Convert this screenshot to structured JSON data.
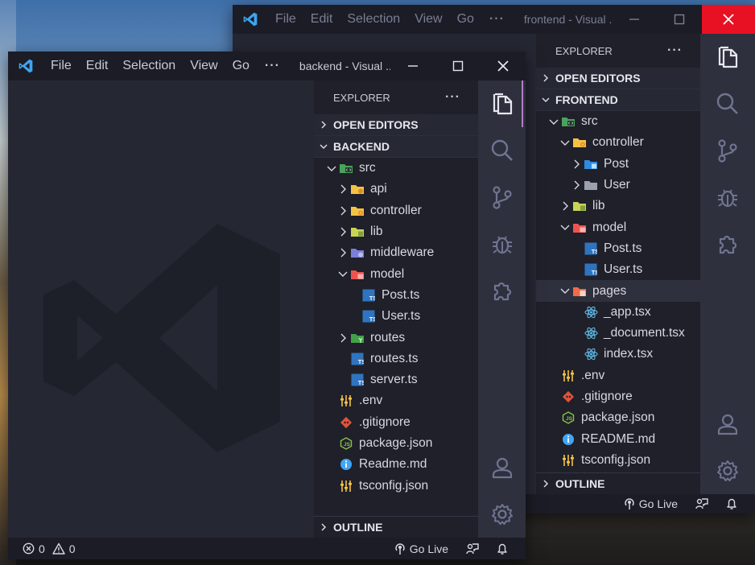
{
  "colors": {
    "title_bg": "#1b1c25",
    "editor_bg": "#252733",
    "sidebar_bg": "#1f2029",
    "activity_bg": "#2e303d",
    "accent_close": "#e81123",
    "vscode_blue": "#3ea5f0",
    "folder_yellow": "#f5c343",
    "ts_blue": "#2f74c0",
    "react_blue": "#5fb8e6"
  },
  "menu": [
    "File",
    "Edit",
    "Selection",
    "View",
    "Go"
  ],
  "menu_more": "···",
  "front": {
    "title": "backend - Visual ...",
    "explorer_title": "EXPLORER",
    "explorer_more": "···",
    "open_editors": "OPEN EDITORS",
    "root": "BACKEND",
    "tree": [
      {
        "label": "src",
        "depth": 1,
        "twisty": "open",
        "icon": "folder-src-icon"
      },
      {
        "label": "api",
        "depth": 2,
        "twisty": "closed",
        "icon": "folder-api-icon"
      },
      {
        "label": "controller",
        "depth": 2,
        "twisty": "closed",
        "icon": "folder-controller-icon"
      },
      {
        "label": "lib",
        "depth": 2,
        "twisty": "closed",
        "icon": "folder-lib-icon"
      },
      {
        "label": "middleware",
        "depth": 2,
        "twisty": "closed",
        "icon": "folder-middleware-icon"
      },
      {
        "label": "model",
        "depth": 2,
        "twisty": "open",
        "icon": "folder-model-icon"
      },
      {
        "label": "Post.ts",
        "depth": 3,
        "twisty": "none",
        "icon": "typescript-icon"
      },
      {
        "label": "User.ts",
        "depth": 3,
        "twisty": "none",
        "icon": "typescript-icon"
      },
      {
        "label": "routes",
        "depth": 2,
        "twisty": "closed",
        "icon": "folder-routes-icon"
      },
      {
        "label": "routes.ts",
        "depth": 2,
        "twisty": "none",
        "icon": "typescript-icon"
      },
      {
        "label": "server.ts",
        "depth": 2,
        "twisty": "none",
        "icon": "typescript-icon"
      },
      {
        "label": ".env",
        "depth": 1,
        "twisty": "none",
        "icon": "env-icon"
      },
      {
        "label": ".gitignore",
        "depth": 1,
        "twisty": "none",
        "icon": "git-icon"
      },
      {
        "label": "package.json",
        "depth": 1,
        "twisty": "none",
        "icon": "nodejs-icon"
      },
      {
        "label": "Readme.md",
        "depth": 1,
        "twisty": "none",
        "icon": "info-icon"
      },
      {
        "label": "tsconfig.json",
        "depth": 1,
        "twisty": "none",
        "icon": "env-icon"
      }
    ],
    "outline": "OUTLINE",
    "status": {
      "errors": "0",
      "warnings": "0",
      "go_live": "Go Live"
    }
  },
  "back": {
    "title": "frontend - Visual ...",
    "explorer_title": "EXPLORER",
    "explorer_more": "···",
    "open_editors": "OPEN EDITORS",
    "root": "FRONTEND",
    "tree": [
      {
        "label": "src",
        "depth": 1,
        "twisty": "open",
        "icon": "folder-src-icon"
      },
      {
        "label": "controller",
        "depth": 2,
        "twisty": "open",
        "icon": "folder-controller-icon"
      },
      {
        "label": "Post",
        "depth": 3,
        "twisty": "closed",
        "icon": "folder-blue-icon"
      },
      {
        "label": "User",
        "depth": 3,
        "twisty": "closed",
        "icon": "folder-grey-icon"
      },
      {
        "label": "lib",
        "depth": 2,
        "twisty": "closed",
        "icon": "folder-lib-icon"
      },
      {
        "label": "model",
        "depth": 2,
        "twisty": "open",
        "icon": "folder-model-icon"
      },
      {
        "label": "Post.ts",
        "depth": 3,
        "twisty": "none",
        "icon": "typescript-icon"
      },
      {
        "label": "User.ts",
        "depth": 3,
        "twisty": "none",
        "icon": "typescript-icon"
      },
      {
        "label": "pages",
        "depth": 2,
        "twisty": "open",
        "icon": "folder-pages-icon",
        "selected": true
      },
      {
        "label": "_app.tsx",
        "depth": 3,
        "twisty": "none",
        "icon": "react-icon"
      },
      {
        "label": "_document.tsx",
        "depth": 3,
        "twisty": "none",
        "icon": "react-icon"
      },
      {
        "label": "index.tsx",
        "depth": 3,
        "twisty": "none",
        "icon": "react-icon"
      },
      {
        "label": ".env",
        "depth": 1,
        "twisty": "none",
        "icon": "env-icon"
      },
      {
        "label": ".gitignore",
        "depth": 1,
        "twisty": "none",
        "icon": "git-icon"
      },
      {
        "label": "package.json",
        "depth": 1,
        "twisty": "none",
        "icon": "nodejs-icon"
      },
      {
        "label": "README.md",
        "depth": 1,
        "twisty": "none",
        "icon": "info-icon"
      },
      {
        "label": "tsconfig.json",
        "depth": 1,
        "twisty": "none",
        "icon": "env-icon"
      }
    ],
    "outline": "OUTLINE",
    "status": {
      "go_live": "Go Live"
    }
  }
}
